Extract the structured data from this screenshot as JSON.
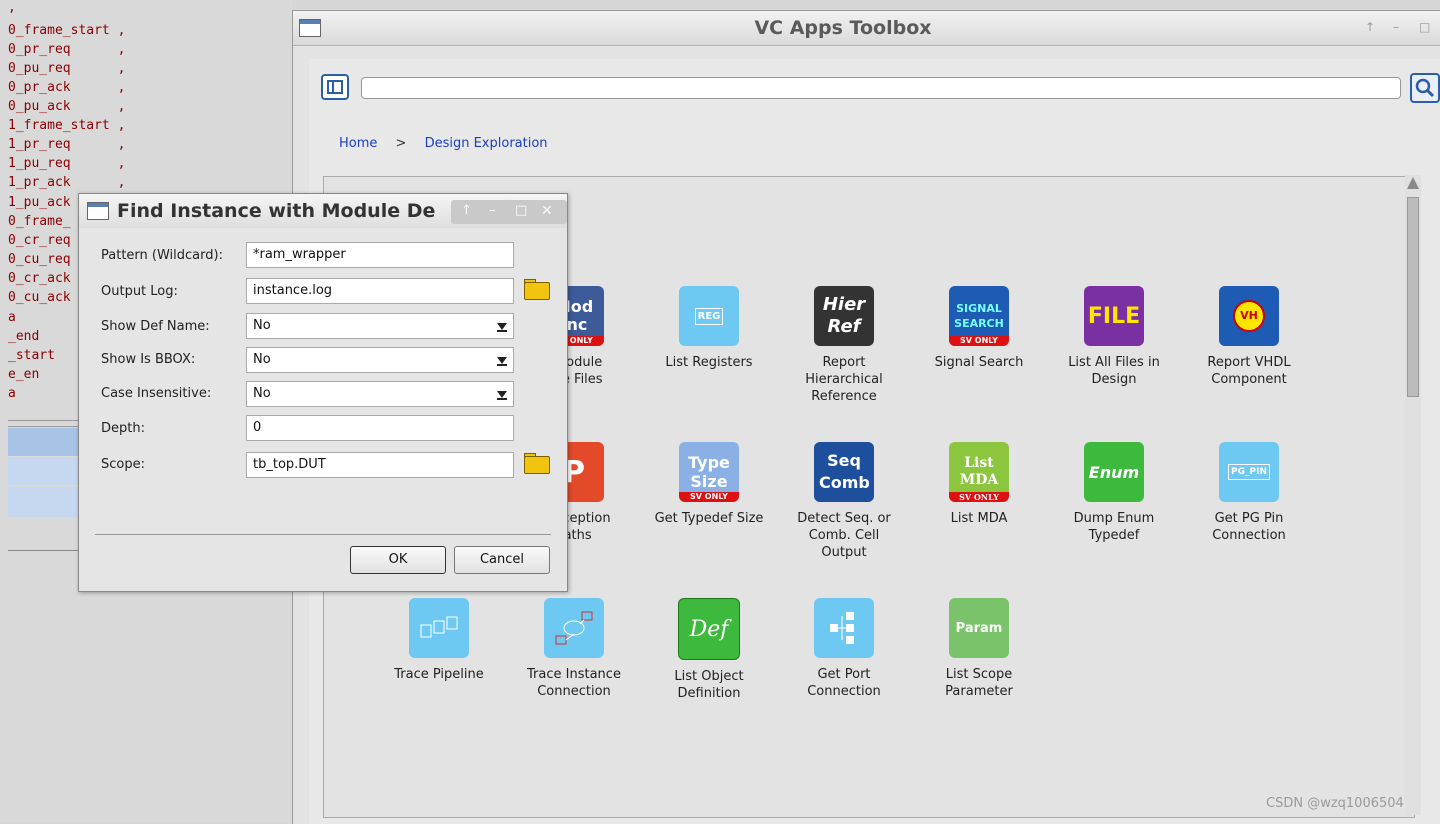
{
  "code_pane": {
    "lines": [
      ",",
      "0_frame_start ,",
      "0_pr_req      ,",
      "0_pu_req      ,",
      "0_pr_ack      ,",
      "0_pu_ack      ,",
      "1_frame_start ,",
      "1_pr_req      ,",
      "1_pu_req      ,",
      "1_pr_ack      ,",
      "1_pu_ack",
      "0_frame_",
      "0_cr_req",
      "0_cu_req",
      "0_cr_ack",
      "0_cu_ack",
      "a",
      "_end",
      "_start",
      "e_en",
      "a"
    ]
  },
  "window": {
    "title": "VC Apps Toolbox",
    "controls": {
      "up": "↑",
      "minimize": "–",
      "maximize": "□"
    }
  },
  "search": {
    "value": "",
    "placeholder": ""
  },
  "breadcrumb": {
    "home": "Home",
    "separator": ">",
    "current": "Design Exploration"
  },
  "apps": [
    {
      "id": "module-include",
      "label": "t Module\nude Files",
      "icon_text": "Mod Inc",
      "badge": "SV ONLY",
      "color": "#3d5a99"
    },
    {
      "id": "list-registers",
      "label": "List Registers",
      "icon_text": "REG",
      "color": "#6ec9f2"
    },
    {
      "id": "report-hier-ref",
      "label": "Report\nHierarchical\nReference",
      "icon_text": "Hier Ref",
      "color": "#333333"
    },
    {
      "id": "signal-search",
      "label": "Signal Search",
      "icon_text": "SIGNAL SEARCH",
      "badge": "SV ONLY",
      "color": "#1e5bb5"
    },
    {
      "id": "list-all-files",
      "label": "List All Files in\nDesign",
      "icon_text": "FILE",
      "color": "#7a2fa3"
    },
    {
      "id": "report-vhdl",
      "label": "Report VHDL\nComponent",
      "icon_text": "VH",
      "color": "#1e5bb5"
    },
    {
      "id": "exception-paths",
      "label": "t Exception\nPaths",
      "icon_text": "P",
      "color": "#e24a2a"
    },
    {
      "id": "typedef-size",
      "label": "Get Typedef Size",
      "icon_text": "Type Size",
      "badge": "SV ONLY",
      "color": "#8ab0e6"
    },
    {
      "id": "seq-comb",
      "label": "Detect Seq. or\nComb. Cell\nOutput",
      "icon_text": "Seq Comb",
      "color": "#1e4f9c"
    },
    {
      "id": "list-mda",
      "label": "List MDA",
      "icon_text": "List MDA",
      "badge": "SV ONLY",
      "color": "#8cc63f"
    },
    {
      "id": "dump-enum",
      "label": "Dump Enum\nTypedef",
      "icon_text": "Enum",
      "color": "#3dba3d"
    },
    {
      "id": "pg-pin",
      "label": "Get PG Pin\nConnection",
      "icon_text": "PG_PIN",
      "color": "#6ec9f2"
    },
    {
      "id": "trace-pipeline",
      "label": "Trace Pipeline",
      "icon_text": "",
      "color": "#6ec9f2"
    },
    {
      "id": "trace-instance",
      "label": "Trace Instance\nConnection",
      "icon_text": "",
      "color": "#6ec9f2"
    },
    {
      "id": "list-object-def",
      "label": "List Object\nDefinition",
      "icon_text": "Def",
      "color": "#3dba3d"
    },
    {
      "id": "port-connection",
      "label": "Get Port\nConnection",
      "icon_text": "",
      "color": "#6ec9f2"
    },
    {
      "id": "scope-param",
      "label": "List Scope\nParameter",
      "icon_text": "Param",
      "color": "#7ac36a"
    }
  ],
  "dialog": {
    "title": "Find Instance with Module De",
    "controls": {
      "up": "↑",
      "minimize": "–",
      "maximize": "□",
      "close": "✕"
    },
    "fields": {
      "pattern_label": "Pattern (Wildcard):",
      "pattern_value": "*ram_wrapper",
      "output_log_label": "Output Log:",
      "output_log_value": "instance.log",
      "show_def_name_label": "Show Def Name:",
      "show_def_name_value": "No",
      "show_bbox_label": "Show Is BBOX:",
      "show_bbox_value": "No",
      "case_insensitive_label": "Case Insensitive:",
      "case_insensitive_value": "No",
      "depth_label": "Depth:",
      "depth_value": "0",
      "scope_label": "Scope:",
      "scope_value": "tb_top.DUT"
    },
    "ok_label": "OK",
    "cancel_label": "Cancel"
  },
  "watermark": "CSDN @wzq1006504"
}
